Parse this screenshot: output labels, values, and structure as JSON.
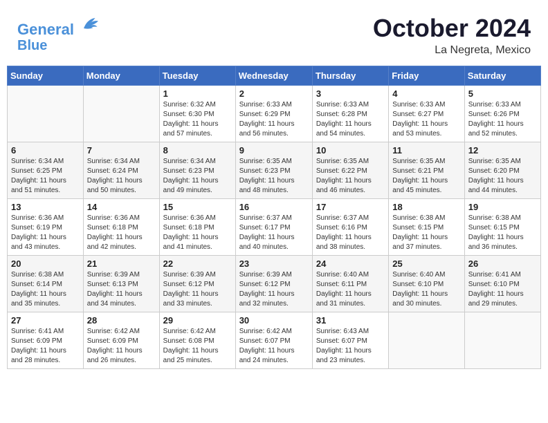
{
  "header": {
    "logo_line1": "General",
    "logo_line2": "Blue",
    "month": "October 2024",
    "location": "La Negreta, Mexico"
  },
  "weekdays": [
    "Sunday",
    "Monday",
    "Tuesday",
    "Wednesday",
    "Thursday",
    "Friday",
    "Saturday"
  ],
  "weeks": [
    [
      {
        "day": "",
        "info": ""
      },
      {
        "day": "",
        "info": ""
      },
      {
        "day": "1",
        "info": "Sunrise: 6:32 AM\nSunset: 6:30 PM\nDaylight: 11 hours\nand 57 minutes."
      },
      {
        "day": "2",
        "info": "Sunrise: 6:33 AM\nSunset: 6:29 PM\nDaylight: 11 hours\nand 56 minutes."
      },
      {
        "day": "3",
        "info": "Sunrise: 6:33 AM\nSunset: 6:28 PM\nDaylight: 11 hours\nand 54 minutes."
      },
      {
        "day": "4",
        "info": "Sunrise: 6:33 AM\nSunset: 6:27 PM\nDaylight: 11 hours\nand 53 minutes."
      },
      {
        "day": "5",
        "info": "Sunrise: 6:33 AM\nSunset: 6:26 PM\nDaylight: 11 hours\nand 52 minutes."
      }
    ],
    [
      {
        "day": "6",
        "info": "Sunrise: 6:34 AM\nSunset: 6:25 PM\nDaylight: 11 hours\nand 51 minutes."
      },
      {
        "day": "7",
        "info": "Sunrise: 6:34 AM\nSunset: 6:24 PM\nDaylight: 11 hours\nand 50 minutes."
      },
      {
        "day": "8",
        "info": "Sunrise: 6:34 AM\nSunset: 6:23 PM\nDaylight: 11 hours\nand 49 minutes."
      },
      {
        "day": "9",
        "info": "Sunrise: 6:35 AM\nSunset: 6:23 PM\nDaylight: 11 hours\nand 48 minutes."
      },
      {
        "day": "10",
        "info": "Sunrise: 6:35 AM\nSunset: 6:22 PM\nDaylight: 11 hours\nand 46 minutes."
      },
      {
        "day": "11",
        "info": "Sunrise: 6:35 AM\nSunset: 6:21 PM\nDaylight: 11 hours\nand 45 minutes."
      },
      {
        "day": "12",
        "info": "Sunrise: 6:35 AM\nSunset: 6:20 PM\nDaylight: 11 hours\nand 44 minutes."
      }
    ],
    [
      {
        "day": "13",
        "info": "Sunrise: 6:36 AM\nSunset: 6:19 PM\nDaylight: 11 hours\nand 43 minutes."
      },
      {
        "day": "14",
        "info": "Sunrise: 6:36 AM\nSunset: 6:18 PM\nDaylight: 11 hours\nand 42 minutes."
      },
      {
        "day": "15",
        "info": "Sunrise: 6:36 AM\nSunset: 6:18 PM\nDaylight: 11 hours\nand 41 minutes."
      },
      {
        "day": "16",
        "info": "Sunrise: 6:37 AM\nSunset: 6:17 PM\nDaylight: 11 hours\nand 40 minutes."
      },
      {
        "day": "17",
        "info": "Sunrise: 6:37 AM\nSunset: 6:16 PM\nDaylight: 11 hours\nand 38 minutes."
      },
      {
        "day": "18",
        "info": "Sunrise: 6:38 AM\nSunset: 6:15 PM\nDaylight: 11 hours\nand 37 minutes."
      },
      {
        "day": "19",
        "info": "Sunrise: 6:38 AM\nSunset: 6:15 PM\nDaylight: 11 hours\nand 36 minutes."
      }
    ],
    [
      {
        "day": "20",
        "info": "Sunrise: 6:38 AM\nSunset: 6:14 PM\nDaylight: 11 hours\nand 35 minutes."
      },
      {
        "day": "21",
        "info": "Sunrise: 6:39 AM\nSunset: 6:13 PM\nDaylight: 11 hours\nand 34 minutes."
      },
      {
        "day": "22",
        "info": "Sunrise: 6:39 AM\nSunset: 6:12 PM\nDaylight: 11 hours\nand 33 minutes."
      },
      {
        "day": "23",
        "info": "Sunrise: 6:39 AM\nSunset: 6:12 PM\nDaylight: 11 hours\nand 32 minutes."
      },
      {
        "day": "24",
        "info": "Sunrise: 6:40 AM\nSunset: 6:11 PM\nDaylight: 11 hours\nand 31 minutes."
      },
      {
        "day": "25",
        "info": "Sunrise: 6:40 AM\nSunset: 6:10 PM\nDaylight: 11 hours\nand 30 minutes."
      },
      {
        "day": "26",
        "info": "Sunrise: 6:41 AM\nSunset: 6:10 PM\nDaylight: 11 hours\nand 29 minutes."
      }
    ],
    [
      {
        "day": "27",
        "info": "Sunrise: 6:41 AM\nSunset: 6:09 PM\nDaylight: 11 hours\nand 28 minutes."
      },
      {
        "day": "28",
        "info": "Sunrise: 6:42 AM\nSunset: 6:09 PM\nDaylight: 11 hours\nand 26 minutes."
      },
      {
        "day": "29",
        "info": "Sunrise: 6:42 AM\nSunset: 6:08 PM\nDaylight: 11 hours\nand 25 minutes."
      },
      {
        "day": "30",
        "info": "Sunrise: 6:42 AM\nSunset: 6:07 PM\nDaylight: 11 hours\nand 24 minutes."
      },
      {
        "day": "31",
        "info": "Sunrise: 6:43 AM\nSunset: 6:07 PM\nDaylight: 11 hours\nand 23 minutes."
      },
      {
        "day": "",
        "info": ""
      },
      {
        "day": "",
        "info": ""
      }
    ]
  ]
}
